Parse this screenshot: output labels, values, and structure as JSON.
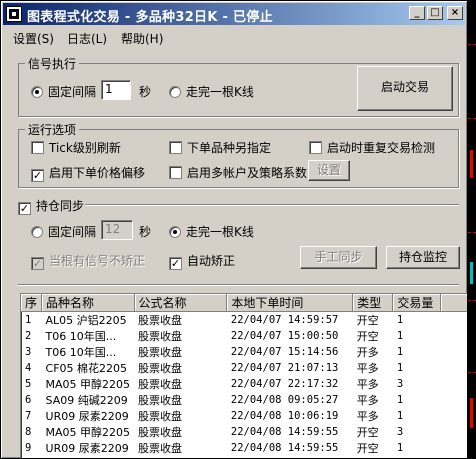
{
  "window": {
    "title": "图表程式化交易 - 多品种32日K - 已停止",
    "minimize_glyph": "_",
    "maximize_glyph": "□",
    "close_glyph": "×"
  },
  "menu": [
    "设置(S)",
    "日志(L)",
    "帮助(H)"
  ],
  "signal": {
    "legend": "信号执行",
    "fixed_interval_label": "固定间隔",
    "interval_value": "1",
    "seconds_label": "秒",
    "bar_complete_label": "走完一根K线",
    "selected": "fixed_interval",
    "start_button": "启动交易"
  },
  "options": {
    "legend": "运行选项",
    "tick_refresh": {
      "label": "Tick级别刷新",
      "checked": false
    },
    "separate_symbol": {
      "label": "下单品种另指定",
      "checked": false
    },
    "startup_recheck": {
      "label": "启动时重复交易检测",
      "checked": false
    },
    "price_offset": {
      "label": "启用下单价格偏移",
      "checked": true
    },
    "multi_account": {
      "label": "启用多帐户及策略系数",
      "checked": false
    },
    "settings_button": "设置"
  },
  "position_sync": {
    "label": "持仓同步",
    "checked": true,
    "fixed_interval_label": "固定间隔",
    "interval_value": "12",
    "seconds_label": "秒",
    "bar_complete_label": "走完一根K线",
    "selected": "bar_complete",
    "no_correct_label": "当根有信号不矫正",
    "no_correct_checked": true,
    "auto_correct_label": "自动矫正",
    "auto_correct_checked": true,
    "manual_sync_button": "手工同步",
    "monitor_button": "持仓监控"
  },
  "table": {
    "columns": [
      "序",
      "品种名称",
      "公式名称",
      "本地下单时间",
      "类型",
      "交易量"
    ],
    "rows": [
      [
        "1",
        "AL05 沪铝2205",
        "股票收盘",
        "22/04/07 14:59:57",
        "开空",
        "1"
      ],
      [
        "2",
        "T06 10年国...",
        "股票收盘",
        "22/04/07 15:00:50",
        "开空",
        "1"
      ],
      [
        "3",
        "T06 10年国...",
        "股票收盘",
        "22/04/07 15:14:56",
        "开多",
        "1"
      ],
      [
        "4",
        "CF05 棉花2205",
        "股票收盘",
        "22/04/07 21:07:13",
        "平多",
        "1"
      ],
      [
        "5",
        "MA05 甲醇2205",
        "股票收盘",
        "22/04/07 22:17:32",
        "平多",
        "3"
      ],
      [
        "6",
        "SA09 纯碱2209",
        "股票收盘",
        "22/04/08 09:05:27",
        "平多",
        "1"
      ],
      [
        "7",
        "UR09 尿素2209",
        "股票收盘",
        "22/04/08 10:06:19",
        "平多",
        "1"
      ],
      [
        "8",
        "MA05 甲醇2205",
        "股票收盘",
        "22/04/08 14:59:55",
        "开空",
        "3"
      ],
      [
        "9",
        "UR09 尿素2209",
        "股票收盘",
        "22/04/08 14:59:55",
        "开空",
        "1"
      ]
    ]
  }
}
